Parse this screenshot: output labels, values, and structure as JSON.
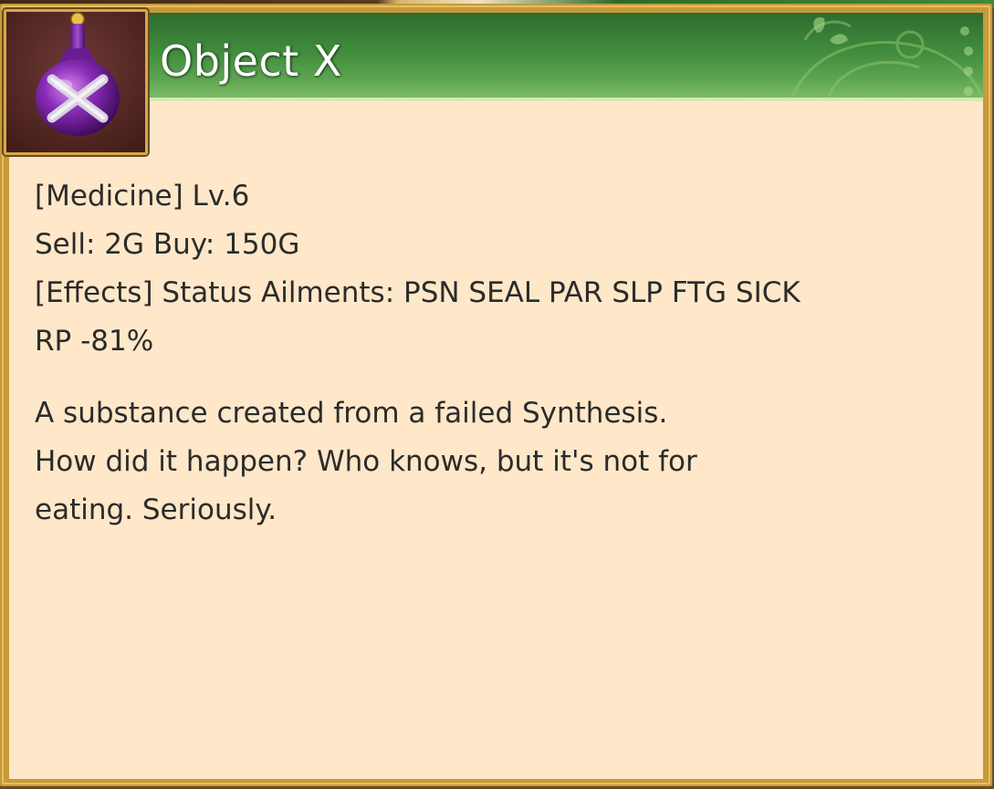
{
  "item": {
    "name": "Object X",
    "icon": "purple-potion-flask-icon"
  },
  "info": {
    "category_line": "[Medicine] Lv.6",
    "price_line": "Sell: 2G Buy: 150G",
    "effects_line": "[Effects] Status Ailments: PSN SEAL PAR SLP FTG SICK",
    "rp_line": "RP -81%"
  },
  "description": {
    "lines": [
      "A substance created from a failed Synthesis.",
      "How did it happen? Who knows, but it's not for",
      "eating. Seriously."
    ]
  },
  "colors": {
    "title_bar": "#3f8a3c",
    "panel_bg": "#ffe8c9",
    "frame": "#c79a3a",
    "text": "#2b2b2b",
    "title_text": "#ffffff"
  }
}
